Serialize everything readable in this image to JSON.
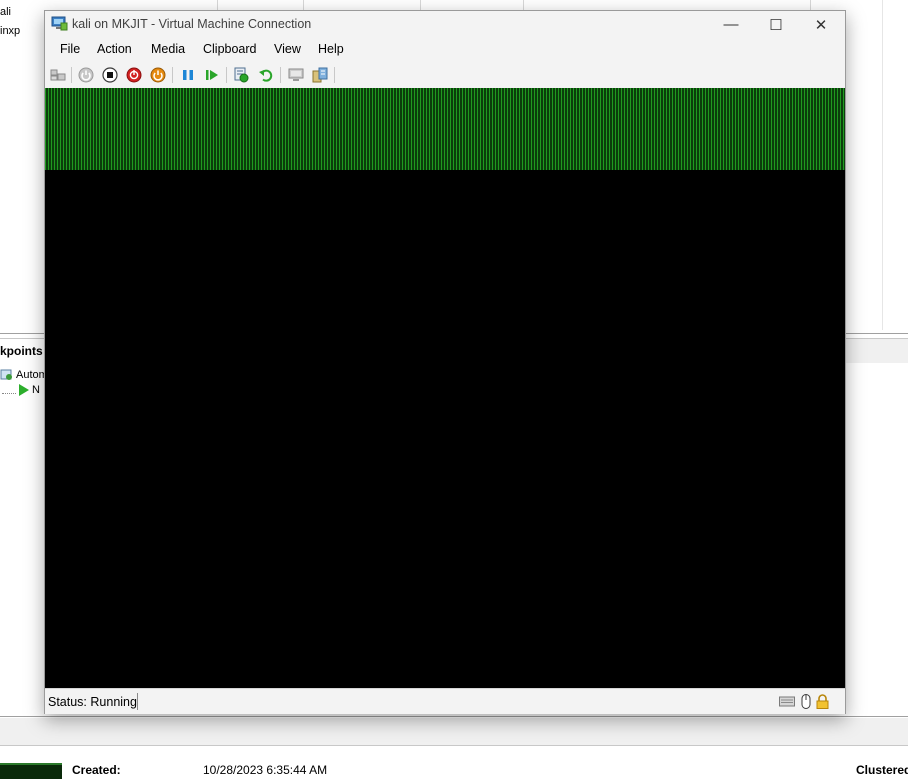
{
  "background": {
    "vm_list": {
      "rows": [
        "ali",
        "inxp"
      ]
    },
    "checkpoints": {
      "title": "kpoints",
      "items": [
        {
          "label": "Autom"
        },
        {
          "label": "N"
        }
      ]
    },
    "details": {
      "created_label": "Created:",
      "created_value": "10/28/2023 6:35:44 AM",
      "clustered_label": "Clustered"
    }
  },
  "window": {
    "title": "kali on MKJIT - Virtual Machine Connection",
    "controls": {
      "minimize": "—",
      "maximize": "☐",
      "close": "✕"
    },
    "menu": [
      "File",
      "Action",
      "Media",
      "Clipboard",
      "View",
      "Help"
    ],
    "toolbar": [
      {
        "name": "ctrl-alt-del-icon"
      },
      {
        "name": "start-icon"
      },
      {
        "name": "turn-off-icon"
      },
      {
        "name": "shut-down-icon"
      },
      {
        "name": "save-state-icon"
      },
      {
        "name": "pause-icon"
      },
      {
        "name": "resume-icon"
      },
      {
        "name": "checkpoint-icon"
      },
      {
        "name": "revert-icon"
      },
      {
        "name": "enhanced-session-icon"
      },
      {
        "name": "share-icon"
      }
    ],
    "status": {
      "text": "Status: Running",
      "icons": [
        "keyboard-icon",
        "mouse-icon",
        "lock-icon"
      ]
    },
    "colors": {
      "screen_bg": "#000000",
      "screen_stripes": "#1f9a1f"
    }
  }
}
